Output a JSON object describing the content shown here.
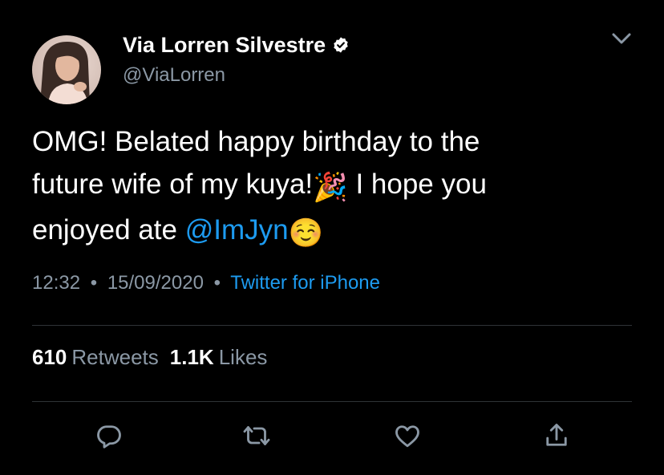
{
  "tweet": {
    "author_name": "Via Lorren Silvestre",
    "handle": "@ViaLorren",
    "text_line1": "OMG! Belated happy birthday to the",
    "text_line2_a": "future wife of my kuya!",
    "text_line2_emoji": "🎉",
    "text_line2_b": " I hope you",
    "text_line3_a": "enjoyed ate ",
    "mention": "@ImJyn",
    "text_line3_emoji": "☺️",
    "time": "12:32",
    "date": "15/09/2020",
    "source": "Twitter for iPhone",
    "separator": "•"
  },
  "stats": {
    "retweets_count": "610",
    "retweets_label": "Retweets",
    "likes_count": "1.1K",
    "likes_label": "Likes"
  },
  "icons": {
    "verified": "verified-badge-icon",
    "menu": "chevron-down-icon",
    "reply": "reply-icon",
    "retweet": "retweet-icon",
    "like": "heart-icon",
    "share": "share-icon"
  },
  "colors": {
    "background": "#000000",
    "text": "#ffffff",
    "muted": "#8b98a5",
    "link": "#1d9bf0",
    "divider": "#2f3336"
  }
}
